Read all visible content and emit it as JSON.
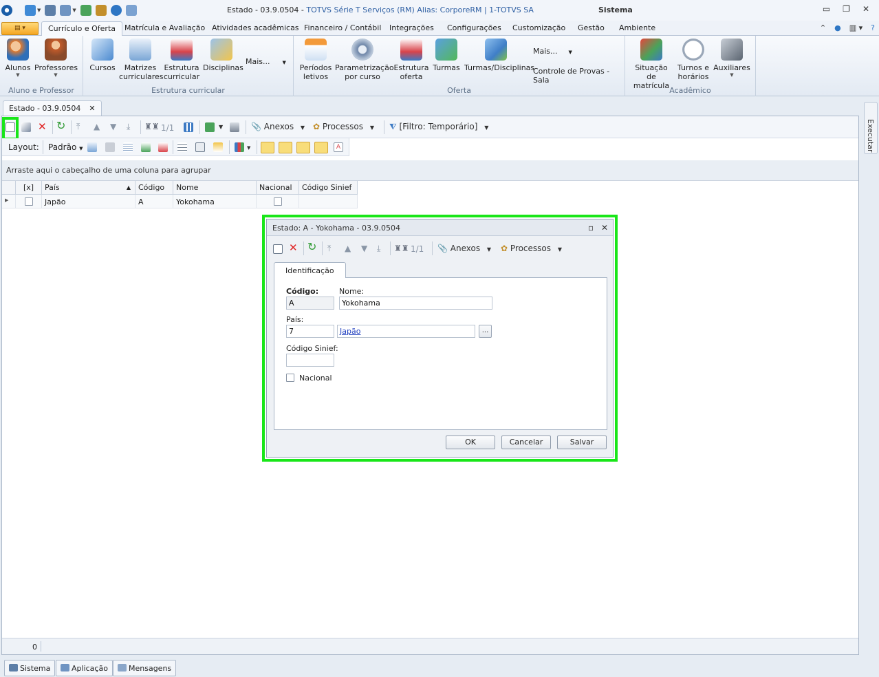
{
  "window": {
    "title_main": "Estado - 03.9.0504 - ",
    "title_sub": "TOTVS Série T Serviços (RM) Alias: CorporeRM | 1-TOTVS SA",
    "system_label": "Sistema"
  },
  "ribbon_tabs": [
    "Currículo e Oferta",
    "Matrícula e Avaliação",
    "Atividades acadêmicas",
    "Financeiro / Contábil",
    "Integrações",
    "Configurações",
    "Customização",
    "Gestão",
    "Ambiente"
  ],
  "ribbon": {
    "groups": [
      {
        "label": "Aluno e Professor",
        "buttons": [
          "Alunos",
          "Professores"
        ]
      },
      {
        "label": "Estrutura curricular",
        "buttons": [
          "Cursos",
          "Matrizes curriculares",
          "Estrutura curricular",
          "Disciplinas"
        ],
        "more": "Mais..."
      },
      {
        "label": "Oferta",
        "buttons": [
          "Períodos letivos",
          "Parametrização por curso",
          "Estrutura oferta",
          "Turmas",
          "Turmas/Disciplinas"
        ],
        "more": "Mais...",
        "extra": "Controle de Provas - Sala"
      },
      {
        "label": "Acadêmico",
        "buttons": [
          "Situação de matrícula",
          "Turnos e horários",
          "Auxiliares"
        ]
      }
    ]
  },
  "doc_tab": {
    "label": "Estado - 03.9.0504",
    "close": "✕"
  },
  "toolbar": {
    "page_counter": "1/1",
    "anexos": "Anexos",
    "processos": "Processos",
    "filtro": "[Filtro: Temporário]",
    "layout_label": "Layout:",
    "layout_value": "Padrão"
  },
  "grid": {
    "group_hint": "Arraste aqui o cabeçalho de uma coluna para agrupar",
    "columns": [
      "[x]",
      "País",
      "Código",
      "Nome",
      "Nacional",
      "Código Sinief"
    ],
    "rows": [
      {
        "pais": "Japão",
        "codigo": "A",
        "nome": "Yokohama"
      }
    ],
    "record_count": "0"
  },
  "sidebar": {
    "label": "Executar"
  },
  "taskbar": [
    "Sistema",
    "Aplicação",
    "Mensagens"
  ],
  "dialog": {
    "title": "Estado: A - Yokohama - 03.9.0504",
    "page_counter": "1/1",
    "anexos": "Anexos",
    "processos": "Processos",
    "tab": "Identificação",
    "fields": {
      "codigo_label": "Código:",
      "codigo_value": "A",
      "nome_label": "Nome:",
      "nome_value": "Yokohama",
      "pais_label": "País:",
      "pais_code": "7",
      "pais_name": "Japão",
      "lookup": "...",
      "sinief_label": "Código Sinief:",
      "sinief_value": "",
      "nacional_label": "Nacional"
    },
    "buttons": {
      "ok": "OK",
      "cancel": "Cancelar",
      "save": "Salvar"
    }
  },
  "colors": {
    "highlight": "#19e619",
    "link": "#1f3fbf",
    "accent": "#2e5fa3"
  }
}
